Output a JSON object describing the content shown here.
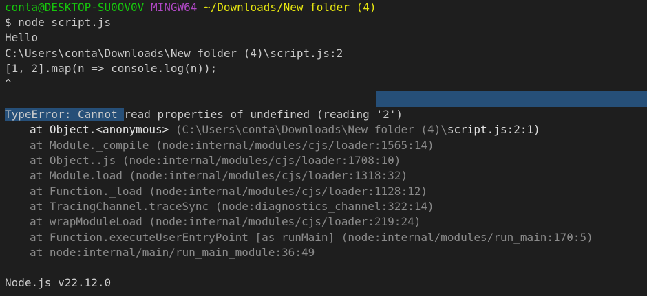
{
  "colors": {
    "background": "#1e1e1e",
    "text": "#cccccc",
    "user_host": "#16c60c",
    "shell_name": "#b148c6",
    "cwd": "#e5e510",
    "selection": "#264f78",
    "dim_text": "#8a8a8a"
  },
  "prompt": {
    "user_host": "conta@DESKTOP-SU0OV0V",
    "shell": "MINGW64",
    "cwd": "~/Downloads/New folder (4)",
    "command": "$ node script.js"
  },
  "output": {
    "hello": "Hello",
    "file_location": "C:\\Users\\conta\\Downloads\\New folder (4)\\script.js:2",
    "source_line": "[1, 2].map(n => console.log(n));",
    "caret": "^",
    "error_selected": "TypeError: Cannot ",
    "error_rest": "read properties of undefined (reading '2')",
    "stack_first_call": "at Object.<anonymous> ",
    "stack_first_loc": "(C:\\Users\\conta\\Downloads\\New folder (4)\\",
    "stack_first_file": "script.js:2:1)",
    "stack": [
      "at Module._compile (node:internal/modules/cjs/loader:1565:14)",
      "at Object..js (node:internal/modules/cjs/loader:1708:10)",
      "at Module.load (node:internal/modules/cjs/loader:1318:32)",
      "at Function._load (node:internal/modules/cjs/loader:1128:12)",
      "at TracingChannel.traceSync (node:diagnostics_channel:322:14)",
      "at wrapModuleLoad (node:internal/modules/cjs/loader:219:24)",
      "at Function.executeUserEntryPoint [as runMain] (node:internal/modules/run_main:170:5)",
      "at node:internal/main/run_main_module:36:49"
    ],
    "node_version": "Node.js v22.12.0"
  }
}
